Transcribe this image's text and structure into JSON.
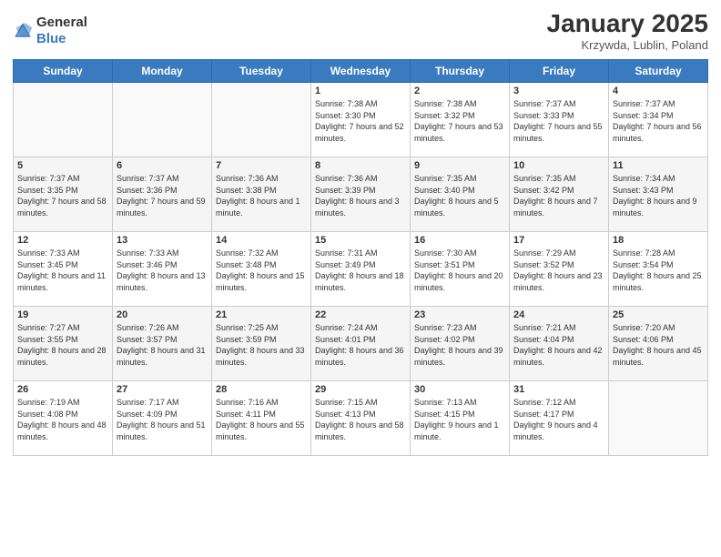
{
  "header": {
    "logo_general": "General",
    "logo_blue": "Blue",
    "month_title": "January 2025",
    "location": "Krzywda, Lublin, Poland"
  },
  "weekdays": [
    "Sunday",
    "Monday",
    "Tuesday",
    "Wednesday",
    "Thursday",
    "Friday",
    "Saturday"
  ],
  "weeks": [
    [
      {
        "day": "",
        "sunrise": "",
        "sunset": "",
        "daylight": ""
      },
      {
        "day": "",
        "sunrise": "",
        "sunset": "",
        "daylight": ""
      },
      {
        "day": "",
        "sunrise": "",
        "sunset": "",
        "daylight": ""
      },
      {
        "day": "1",
        "sunrise": "Sunrise: 7:38 AM",
        "sunset": "Sunset: 3:30 PM",
        "daylight": "Daylight: 7 hours and 52 minutes."
      },
      {
        "day": "2",
        "sunrise": "Sunrise: 7:38 AM",
        "sunset": "Sunset: 3:32 PM",
        "daylight": "Daylight: 7 hours and 53 minutes."
      },
      {
        "day": "3",
        "sunrise": "Sunrise: 7:37 AM",
        "sunset": "Sunset: 3:33 PM",
        "daylight": "Daylight: 7 hours and 55 minutes."
      },
      {
        "day": "4",
        "sunrise": "Sunrise: 7:37 AM",
        "sunset": "Sunset: 3:34 PM",
        "daylight": "Daylight: 7 hours and 56 minutes."
      }
    ],
    [
      {
        "day": "5",
        "sunrise": "Sunrise: 7:37 AM",
        "sunset": "Sunset: 3:35 PM",
        "daylight": "Daylight: 7 hours and 58 minutes."
      },
      {
        "day": "6",
        "sunrise": "Sunrise: 7:37 AM",
        "sunset": "Sunset: 3:36 PM",
        "daylight": "Daylight: 7 hours and 59 minutes."
      },
      {
        "day": "7",
        "sunrise": "Sunrise: 7:36 AM",
        "sunset": "Sunset: 3:38 PM",
        "daylight": "Daylight: 8 hours and 1 minute."
      },
      {
        "day": "8",
        "sunrise": "Sunrise: 7:36 AM",
        "sunset": "Sunset: 3:39 PM",
        "daylight": "Daylight: 8 hours and 3 minutes."
      },
      {
        "day": "9",
        "sunrise": "Sunrise: 7:35 AM",
        "sunset": "Sunset: 3:40 PM",
        "daylight": "Daylight: 8 hours and 5 minutes."
      },
      {
        "day": "10",
        "sunrise": "Sunrise: 7:35 AM",
        "sunset": "Sunset: 3:42 PM",
        "daylight": "Daylight: 8 hours and 7 minutes."
      },
      {
        "day": "11",
        "sunrise": "Sunrise: 7:34 AM",
        "sunset": "Sunset: 3:43 PM",
        "daylight": "Daylight: 8 hours and 9 minutes."
      }
    ],
    [
      {
        "day": "12",
        "sunrise": "Sunrise: 7:33 AM",
        "sunset": "Sunset: 3:45 PM",
        "daylight": "Daylight: 8 hours and 11 minutes."
      },
      {
        "day": "13",
        "sunrise": "Sunrise: 7:33 AM",
        "sunset": "Sunset: 3:46 PM",
        "daylight": "Daylight: 8 hours and 13 minutes."
      },
      {
        "day": "14",
        "sunrise": "Sunrise: 7:32 AM",
        "sunset": "Sunset: 3:48 PM",
        "daylight": "Daylight: 8 hours and 15 minutes."
      },
      {
        "day": "15",
        "sunrise": "Sunrise: 7:31 AM",
        "sunset": "Sunset: 3:49 PM",
        "daylight": "Daylight: 8 hours and 18 minutes."
      },
      {
        "day": "16",
        "sunrise": "Sunrise: 7:30 AM",
        "sunset": "Sunset: 3:51 PM",
        "daylight": "Daylight: 8 hours and 20 minutes."
      },
      {
        "day": "17",
        "sunrise": "Sunrise: 7:29 AM",
        "sunset": "Sunset: 3:52 PM",
        "daylight": "Daylight: 8 hours and 23 minutes."
      },
      {
        "day": "18",
        "sunrise": "Sunrise: 7:28 AM",
        "sunset": "Sunset: 3:54 PM",
        "daylight": "Daylight: 8 hours and 25 minutes."
      }
    ],
    [
      {
        "day": "19",
        "sunrise": "Sunrise: 7:27 AM",
        "sunset": "Sunset: 3:55 PM",
        "daylight": "Daylight: 8 hours and 28 minutes."
      },
      {
        "day": "20",
        "sunrise": "Sunrise: 7:26 AM",
        "sunset": "Sunset: 3:57 PM",
        "daylight": "Daylight: 8 hours and 31 minutes."
      },
      {
        "day": "21",
        "sunrise": "Sunrise: 7:25 AM",
        "sunset": "Sunset: 3:59 PM",
        "daylight": "Daylight: 8 hours and 33 minutes."
      },
      {
        "day": "22",
        "sunrise": "Sunrise: 7:24 AM",
        "sunset": "Sunset: 4:01 PM",
        "daylight": "Daylight: 8 hours and 36 minutes."
      },
      {
        "day": "23",
        "sunrise": "Sunrise: 7:23 AM",
        "sunset": "Sunset: 4:02 PM",
        "daylight": "Daylight: 8 hours and 39 minutes."
      },
      {
        "day": "24",
        "sunrise": "Sunrise: 7:21 AM",
        "sunset": "Sunset: 4:04 PM",
        "daylight": "Daylight: 8 hours and 42 minutes."
      },
      {
        "day": "25",
        "sunrise": "Sunrise: 7:20 AM",
        "sunset": "Sunset: 4:06 PM",
        "daylight": "Daylight: 8 hours and 45 minutes."
      }
    ],
    [
      {
        "day": "26",
        "sunrise": "Sunrise: 7:19 AM",
        "sunset": "Sunset: 4:08 PM",
        "daylight": "Daylight: 8 hours and 48 minutes."
      },
      {
        "day": "27",
        "sunrise": "Sunrise: 7:17 AM",
        "sunset": "Sunset: 4:09 PM",
        "daylight": "Daylight: 8 hours and 51 minutes."
      },
      {
        "day": "28",
        "sunrise": "Sunrise: 7:16 AM",
        "sunset": "Sunset: 4:11 PM",
        "daylight": "Daylight: 8 hours and 55 minutes."
      },
      {
        "day": "29",
        "sunrise": "Sunrise: 7:15 AM",
        "sunset": "Sunset: 4:13 PM",
        "daylight": "Daylight: 8 hours and 58 minutes."
      },
      {
        "day": "30",
        "sunrise": "Sunrise: 7:13 AM",
        "sunset": "Sunset: 4:15 PM",
        "daylight": "Daylight: 9 hours and 1 minute."
      },
      {
        "day": "31",
        "sunrise": "Sunrise: 7:12 AM",
        "sunset": "Sunset: 4:17 PM",
        "daylight": "Daylight: 9 hours and 4 minutes."
      },
      {
        "day": "",
        "sunrise": "",
        "sunset": "",
        "daylight": ""
      }
    ]
  ]
}
